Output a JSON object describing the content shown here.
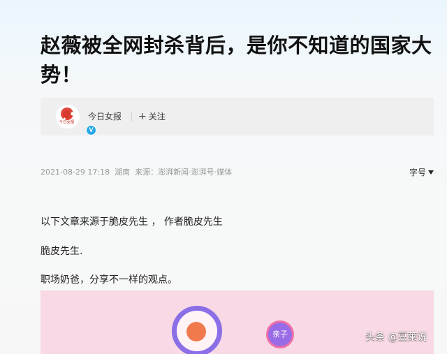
{
  "article": {
    "title": "赵薇被全网封杀背后，是你不知道的国家大势！",
    "author": {
      "name": "今日女报",
      "avatar_text": "今日女报",
      "verified_mark": "V",
      "follow_icon": "plus-icon",
      "follow_label": "关注"
    },
    "meta": {
      "datetime": "2021-08-29 17:18",
      "location": "湖南",
      "source": "来源：澎湃新闻·澎湃号·媒体"
    },
    "font_size_label": "字号",
    "paragraphs": [
      "以下文章来源于脆皮先生 ， 作者脆皮先生",
      "脆皮先生.",
      "职场奶爸，分享不一样的观点。"
    ],
    "image": {
      "tag_label": "亲子"
    }
  },
  "watermark": "头条 @豆莱说",
  "colors": {
    "title": "#111111",
    "meta": "#999999",
    "image_bg": "#f8d9e5",
    "ring": "#8a6fe6",
    "dot": "#f07a4e",
    "tag_bg": "#9a6be6",
    "tag_border": "#f06ea8",
    "verified": "#2aa8e8"
  }
}
